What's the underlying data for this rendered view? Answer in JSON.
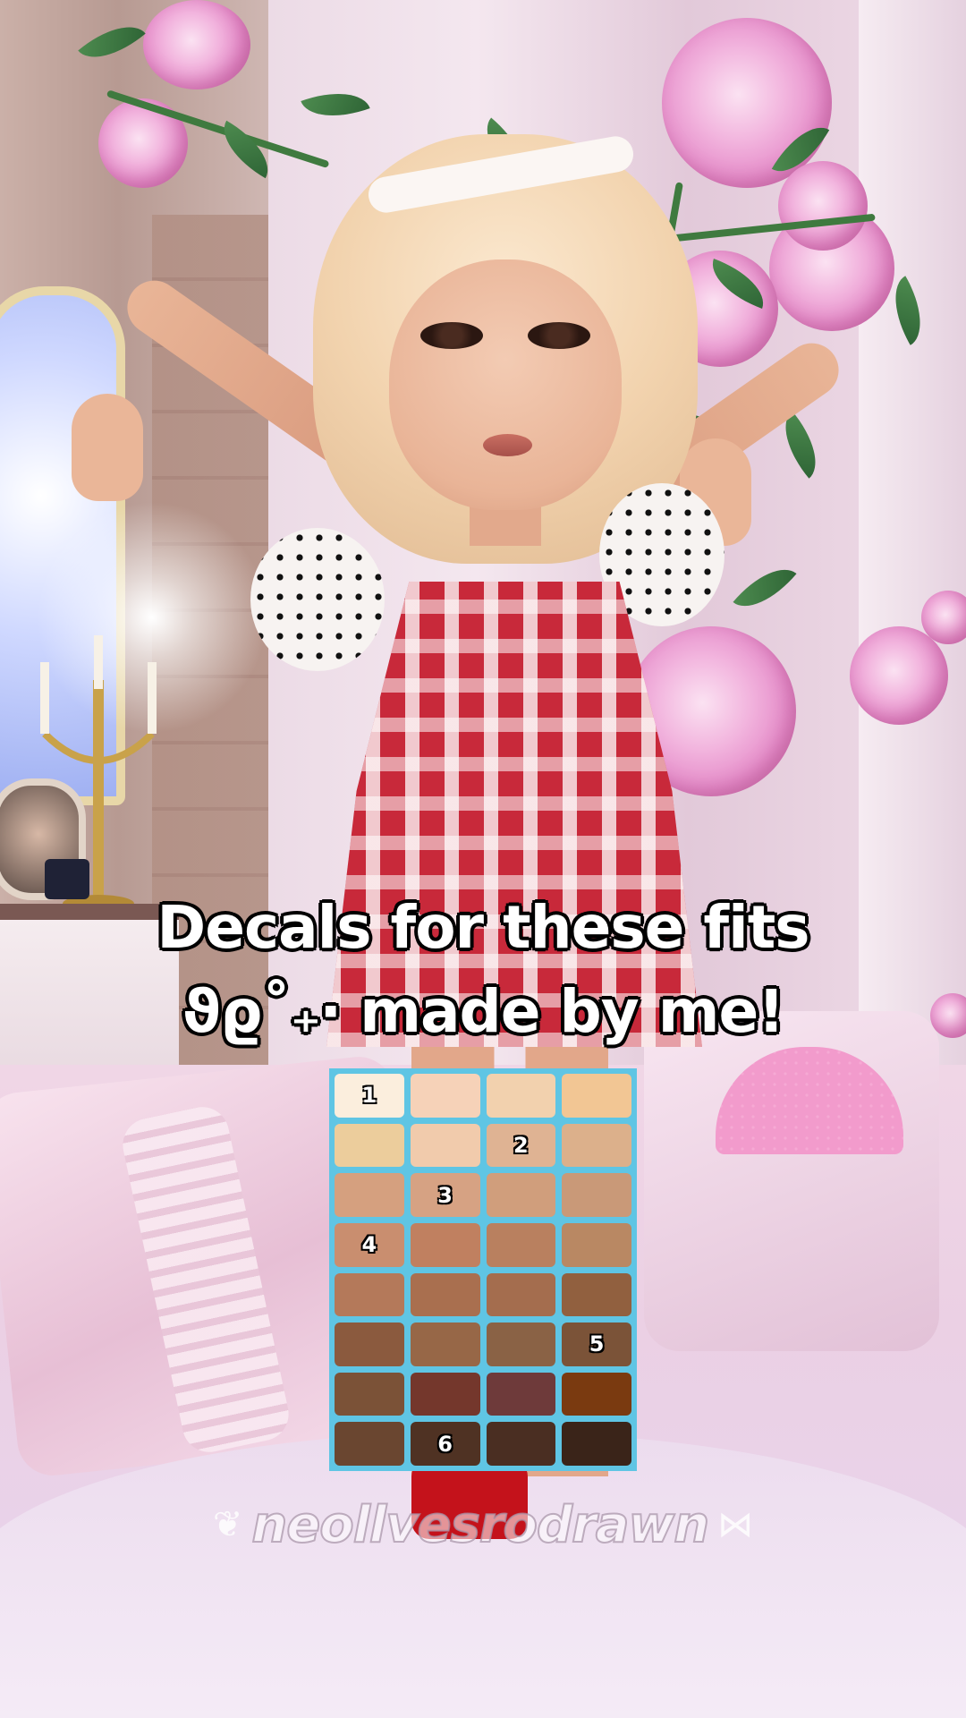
{
  "caption": {
    "line1": "Decals for these fits",
    "line2": "ϑϱ˚₊‧ made by me!"
  },
  "palette": {
    "columns": 4,
    "border_color": "#5fc5e4",
    "swatches": [
      {
        "color": "#fbeedd",
        "label": "1"
      },
      {
        "color": "#f6d2b8",
        "label": ""
      },
      {
        "color": "#f2d1ae",
        "label": ""
      },
      {
        "color": "#f2c694",
        "label": ""
      },
      {
        "color": "#eccd9c",
        "label": ""
      },
      {
        "color": "#f1cbac",
        "label": ""
      },
      {
        "color": "#dfb393",
        "label": "2"
      },
      {
        "color": "#dcb08b",
        "label": ""
      },
      {
        "color": "#d5a07f",
        "label": ""
      },
      {
        "color": "#d6a283",
        "label": "3"
      },
      {
        "color": "#d09e7c",
        "label": ""
      },
      {
        "color": "#c99978",
        "label": ""
      },
      {
        "color": "#c98e6f",
        "label": "4"
      },
      {
        "color": "#c08060",
        "label": ""
      },
      {
        "color": "#b9805f",
        "label": ""
      },
      {
        "color": "#b98863",
        "label": ""
      },
      {
        "color": "#b4795a",
        "label": ""
      },
      {
        "color": "#a96f4f",
        "label": ""
      },
      {
        "color": "#a46d4e",
        "label": ""
      },
      {
        "color": "#91603f",
        "label": ""
      },
      {
        "color": "#8b5a3e",
        "label": ""
      },
      {
        "color": "#976747",
        "label": ""
      },
      {
        "color": "#8a6245",
        "label": ""
      },
      {
        "color": "#7b5338",
        "label": "5"
      },
      {
        "color": "#7b5237",
        "label": ""
      },
      {
        "color": "#74372c",
        "label": ""
      },
      {
        "color": "#6e3a3a",
        "label": ""
      },
      {
        "color": "#7a3a10",
        "label": ""
      },
      {
        "color": "#6a4630",
        "label": ""
      },
      {
        "color": "#4f3223",
        "label": "6"
      },
      {
        "color": "#4a2e22",
        "label": ""
      },
      {
        "color": "#3a2419",
        "label": ""
      }
    ]
  },
  "watermark": {
    "text": "neollvesrodrawn",
    "left_icon": "wing-icon",
    "right_icon": "bow-icon"
  }
}
